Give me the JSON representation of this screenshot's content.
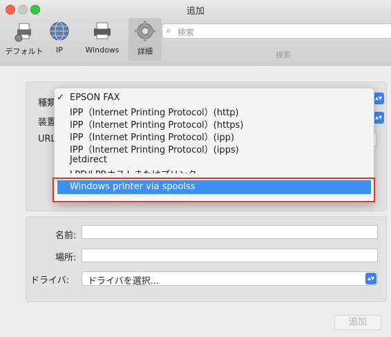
{
  "window": {
    "title": "追加"
  },
  "toolbar": {
    "items": [
      {
        "label": "デフォルト"
      },
      {
        "label": "IP"
      },
      {
        "label": "Windows"
      },
      {
        "label": "詳細"
      }
    ],
    "search": {
      "placeholder": "検索",
      "label": "検索"
    }
  },
  "connection": {
    "type_label": "種類",
    "device_label": "装置",
    "url_label": "URL",
    "menu": {
      "items": [
        {
          "label": "EPSON FAX",
          "checked": true
        },
        {
          "label": "IPP（Internet Printing Protocol）(http)"
        },
        {
          "label": "IPP（Internet Printing Protocol）(https)"
        },
        {
          "label": "IPP（Internet Printing Protocol）(ipp)"
        },
        {
          "label": "IPP（Internet Printing Protocol）(ipps)"
        },
        {
          "label": "Jetdirect"
        },
        {
          "label": "LPD/LPRホストまたはプリンタ"
        }
      ],
      "highlighted": "Windows printer via spoolss",
      "check_glyph": "✓"
    }
  },
  "printer": {
    "name_label": "名前:",
    "name_value": "",
    "location_label": "場所:",
    "location_value": "",
    "driver_label": "ドライバ:",
    "driver_value": "ドライバを選択..."
  },
  "footer": {
    "add_label": "追加"
  },
  "colors": {
    "accent": "#3d8ef5",
    "highlight_border": "#d83a33"
  }
}
